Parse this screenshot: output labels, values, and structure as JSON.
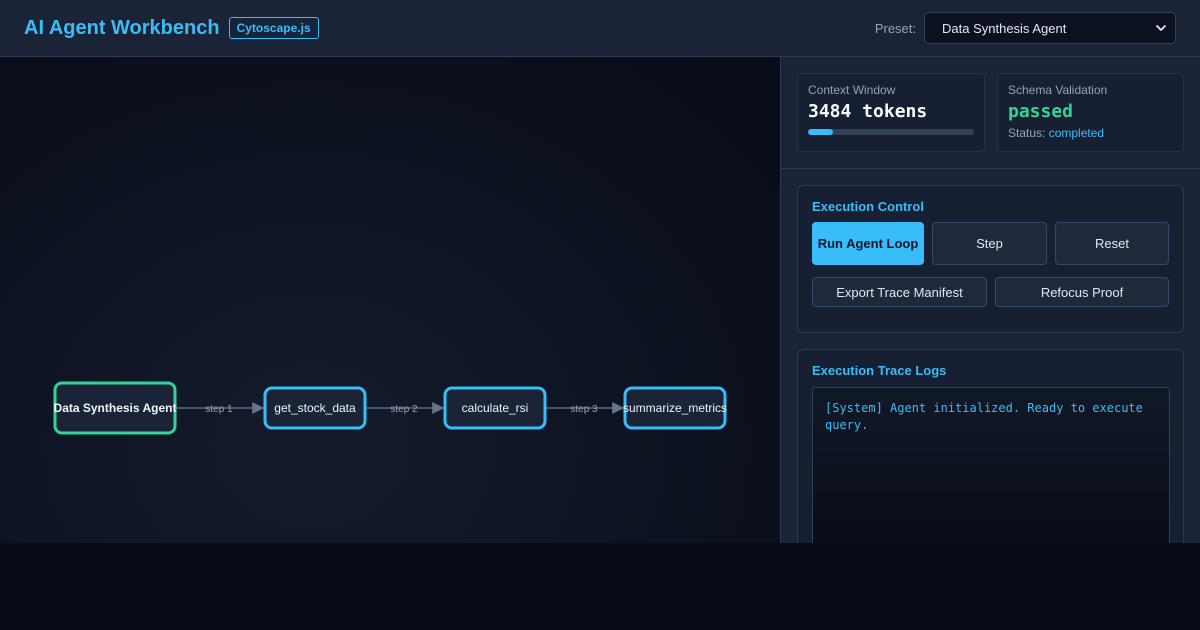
{
  "header": {
    "title": "AI Agent Workbench",
    "badge": "Cytoscape.js",
    "preset_label": "Preset:",
    "preset_value": "Data Synthesis Agent"
  },
  "graph": {
    "nodes": [
      {
        "id": "agent",
        "label": "Data Synthesis Agent",
        "kind": "agent"
      },
      {
        "id": "get_stock_data",
        "label": "get_stock_data",
        "kind": "tool"
      },
      {
        "id": "calculate_rsi",
        "label": "calculate_rsi",
        "kind": "tool"
      },
      {
        "id": "summarize_metrics",
        "label": "summarize_metrics",
        "kind": "tool"
      }
    ],
    "edges": [
      {
        "from": "agent",
        "to": "get_stock_data",
        "label": "step 1"
      },
      {
        "from": "get_stock_data",
        "to": "calculate_rsi",
        "label": "step 2"
      },
      {
        "from": "calculate_rsi",
        "to": "summarize_metrics",
        "label": "step 3"
      }
    ]
  },
  "context": {
    "label": "Context Window",
    "value": "3484 tokens",
    "usage_fraction": 0.15
  },
  "schema": {
    "label": "Schema Validation",
    "value": "passed",
    "status_label": "Status:",
    "status_value": "completed"
  },
  "execution": {
    "title": "Execution Control",
    "run_label": "Run Agent Loop",
    "step_label": "Step",
    "reset_label": "Reset",
    "export_label": "Export Trace Manifest",
    "refocus_label": "Refocus Proof"
  },
  "logs": {
    "title": "Execution Trace Logs",
    "lines": [
      "[System] Agent initialized. Ready to execute query."
    ]
  },
  "colors": {
    "accent": "#38bdf8",
    "agent_border": "#34d399",
    "tool_border": "#38bdf8",
    "success": "#34d399"
  },
  "icons": {
    "preset_chevron": "chevron-down-icon"
  }
}
